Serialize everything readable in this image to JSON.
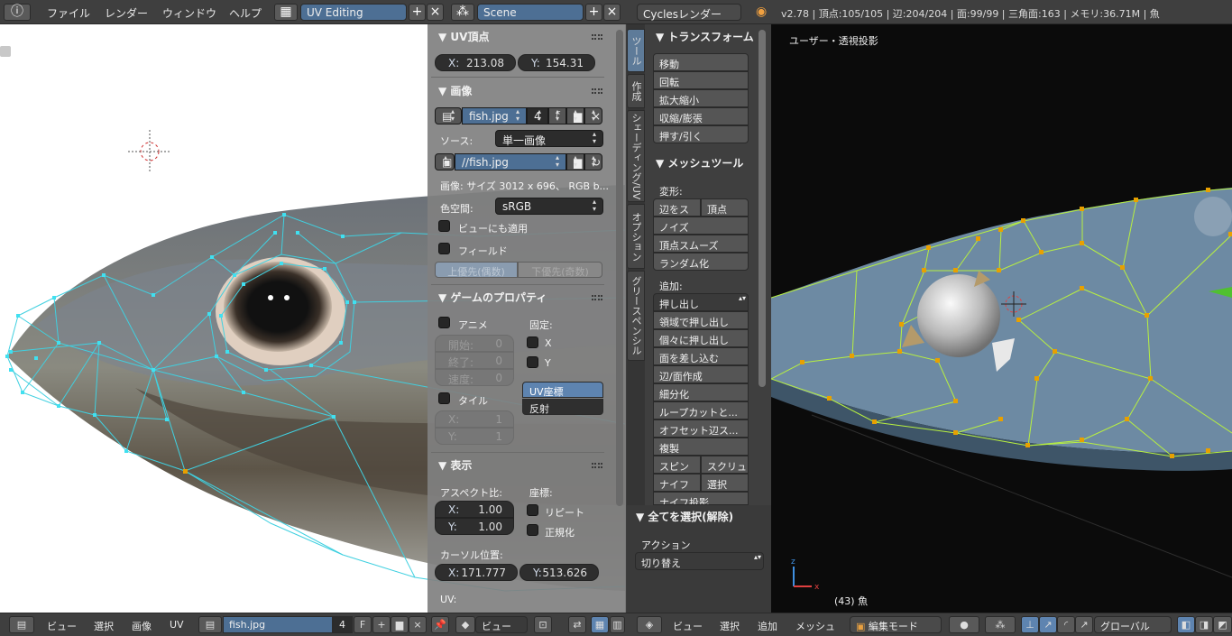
{
  "topbar": {
    "menus": [
      "ファイル",
      "レンダー",
      "ウィンドウ",
      "ヘルプ"
    ],
    "screen_layout": "UV Editing",
    "scene": "Scene",
    "render_engine": "Cyclesレンダー",
    "stats": "v2.78 | 頂点:105/105 | 辺:204/204 | 面:99/99 | 三角面:163 | メモリ:36.71M | 魚"
  },
  "uv_panel": {
    "uv_vertex": {
      "title": "UV頂点",
      "x_label": "X:",
      "x_value": "213.08",
      "y_label": "Y:",
      "y_value": "154.31"
    },
    "image": {
      "title": "画像",
      "image_name": "fish.jpg",
      "users": "4",
      "fake_user": "F",
      "source_label": "ソース:",
      "source_value": "単一画像",
      "filepath": "//fish.jpg",
      "info": "画像: サイズ 3012 x 696、 RGB b...",
      "colorspace_label": "色空間:",
      "colorspace_value": "sRGB",
      "view_as_render": "ビューにも適用",
      "fields": "フィールド",
      "upper_first": "上優先(偶数)",
      "lower_first": "下優先(奇数)"
    },
    "game": {
      "title": "ゲームのプロパティ",
      "animate": "アニメ",
      "start_label": "開始:",
      "start_value": "0",
      "end_label": "終了:",
      "end_value": "0",
      "speed_label": "速度:",
      "speed_value": "0",
      "clamp_label": "固定:",
      "clamp_x": "X",
      "clamp_y": "Y",
      "tile": "タイル",
      "tile_x_label": "X:",
      "tile_x_value": "1",
      "tile_y_label": "Y:",
      "tile_y_value": "1",
      "mapping_uv": "UV座標",
      "mapping_reflection": "反射"
    },
    "display": {
      "title": "表示",
      "aspect_label": "アスペクト比:",
      "aspect_x_label": "X:",
      "aspect_x_value": "1.00",
      "aspect_y_label": "Y:",
      "aspect_y_value": "1.00",
      "coords_label": "座標:",
      "repeat": "リピート",
      "normalized": "正規化",
      "cursor_label": "カーソル位置:",
      "cursor_x_label": "X:",
      "cursor_x_value": "171.777",
      "cursor_y_label": "Y:",
      "cursor_y_value": "513.626",
      "uv_label": "UV:"
    }
  },
  "tool_tabs": [
    "ツール",
    "作成",
    "シェーディング/UV",
    "オプション",
    "グリースペンシル"
  ],
  "tool_shelf": {
    "transform_title": "トランスフォーム",
    "transform_buttons": [
      "移動",
      "回転",
      "拡大縮小",
      "収縮/膨張",
      "押す/引く"
    ],
    "mesh_tools_title": "メッシュツール",
    "deform_label": "変形:",
    "deform_row": [
      "辺をス",
      "頂点"
    ],
    "deform_buttons": [
      "ノイズ",
      "頂点スムーズ",
      "ランダム化"
    ],
    "add_label": "追加:",
    "extrude_dropdown": "押し出し",
    "add_buttons": [
      "領域で押し出し",
      "個々に押し出し",
      "面を差し込む",
      "辺/面作成",
      "細分化",
      "ループカットと...",
      "オフセット辺ス...",
      "複製"
    ],
    "spin_row": [
      "スピン",
      "スクリュ"
    ],
    "knife_row": [
      "ナイフ",
      "選択"
    ],
    "knife_project": "ナイフ投影"
  },
  "select_panel": {
    "title": "全てを選択(解除)",
    "action_label": "アクション",
    "action_value": "切り替え"
  },
  "viewport": {
    "title": "ユーザー・透視投影",
    "object_label": "(43) 魚"
  },
  "uv_footer": {
    "menus": [
      "ビュー",
      "選択",
      "画像",
      "UV"
    ],
    "image_name": "fish.jpg",
    "users": "4",
    "fake_user": "F",
    "view_dropdown": "ビュー"
  },
  "viewport_footer": {
    "menus": [
      "ビュー",
      "選択",
      "追加",
      "メッシュ"
    ],
    "mode": "編集モード",
    "orientation": "グローバル"
  },
  "colors": {
    "uv_wire": "#40d0e0",
    "mesh_wire": "#b8f040",
    "vertex_selected": "#e8a000",
    "header": "#3f3f3f",
    "accent": "#5e84b0"
  }
}
